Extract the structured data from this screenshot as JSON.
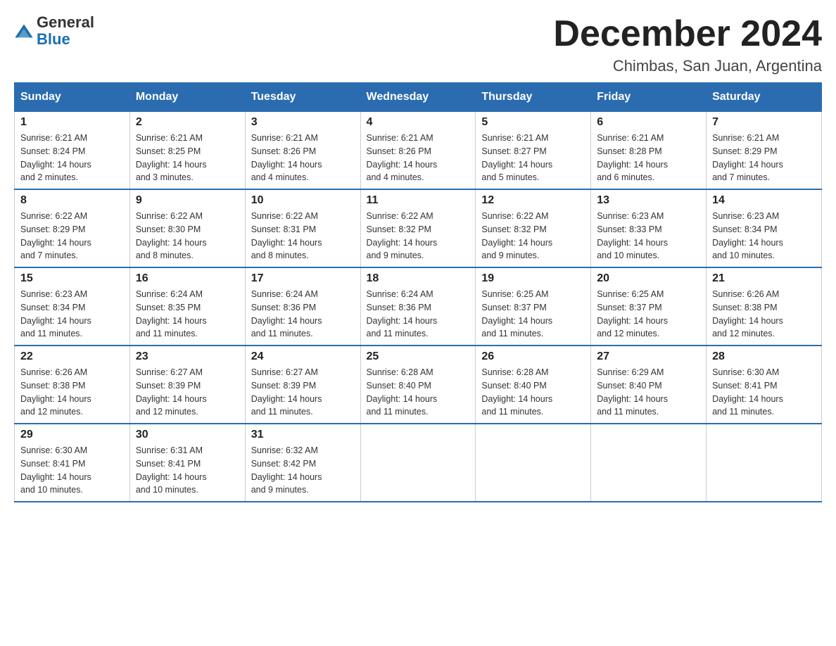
{
  "header": {
    "logo": {
      "general": "General",
      "blue": "Blue"
    },
    "title": "December 2024",
    "subtitle": "Chimbas, San Juan, Argentina"
  },
  "weekdays": [
    "Sunday",
    "Monday",
    "Tuesday",
    "Wednesday",
    "Thursday",
    "Friday",
    "Saturday"
  ],
  "weeks": [
    [
      {
        "day": "1",
        "sunrise": "6:21 AM",
        "sunset": "8:24 PM",
        "daylight": "14 hours and 2 minutes."
      },
      {
        "day": "2",
        "sunrise": "6:21 AM",
        "sunset": "8:25 PM",
        "daylight": "14 hours and 3 minutes."
      },
      {
        "day": "3",
        "sunrise": "6:21 AM",
        "sunset": "8:26 PM",
        "daylight": "14 hours and 4 minutes."
      },
      {
        "day": "4",
        "sunrise": "6:21 AM",
        "sunset": "8:26 PM",
        "daylight": "14 hours and 4 minutes."
      },
      {
        "day": "5",
        "sunrise": "6:21 AM",
        "sunset": "8:27 PM",
        "daylight": "14 hours and 5 minutes."
      },
      {
        "day": "6",
        "sunrise": "6:21 AM",
        "sunset": "8:28 PM",
        "daylight": "14 hours and 6 minutes."
      },
      {
        "day": "7",
        "sunrise": "6:21 AM",
        "sunset": "8:29 PM",
        "daylight": "14 hours and 7 minutes."
      }
    ],
    [
      {
        "day": "8",
        "sunrise": "6:22 AM",
        "sunset": "8:29 PM",
        "daylight": "14 hours and 7 minutes."
      },
      {
        "day": "9",
        "sunrise": "6:22 AM",
        "sunset": "8:30 PM",
        "daylight": "14 hours and 8 minutes."
      },
      {
        "day": "10",
        "sunrise": "6:22 AM",
        "sunset": "8:31 PM",
        "daylight": "14 hours and 8 minutes."
      },
      {
        "day": "11",
        "sunrise": "6:22 AM",
        "sunset": "8:32 PM",
        "daylight": "14 hours and 9 minutes."
      },
      {
        "day": "12",
        "sunrise": "6:22 AM",
        "sunset": "8:32 PM",
        "daylight": "14 hours and 9 minutes."
      },
      {
        "day": "13",
        "sunrise": "6:23 AM",
        "sunset": "8:33 PM",
        "daylight": "14 hours and 10 minutes."
      },
      {
        "day": "14",
        "sunrise": "6:23 AM",
        "sunset": "8:34 PM",
        "daylight": "14 hours and 10 minutes."
      }
    ],
    [
      {
        "day": "15",
        "sunrise": "6:23 AM",
        "sunset": "8:34 PM",
        "daylight": "14 hours and 11 minutes."
      },
      {
        "day": "16",
        "sunrise": "6:24 AM",
        "sunset": "8:35 PM",
        "daylight": "14 hours and 11 minutes."
      },
      {
        "day": "17",
        "sunrise": "6:24 AM",
        "sunset": "8:36 PM",
        "daylight": "14 hours and 11 minutes."
      },
      {
        "day": "18",
        "sunrise": "6:24 AM",
        "sunset": "8:36 PM",
        "daylight": "14 hours and 11 minutes."
      },
      {
        "day": "19",
        "sunrise": "6:25 AM",
        "sunset": "8:37 PM",
        "daylight": "14 hours and 11 minutes."
      },
      {
        "day": "20",
        "sunrise": "6:25 AM",
        "sunset": "8:37 PM",
        "daylight": "14 hours and 12 minutes."
      },
      {
        "day": "21",
        "sunrise": "6:26 AM",
        "sunset": "8:38 PM",
        "daylight": "14 hours and 12 minutes."
      }
    ],
    [
      {
        "day": "22",
        "sunrise": "6:26 AM",
        "sunset": "8:38 PM",
        "daylight": "14 hours and 12 minutes."
      },
      {
        "day": "23",
        "sunrise": "6:27 AM",
        "sunset": "8:39 PM",
        "daylight": "14 hours and 12 minutes."
      },
      {
        "day": "24",
        "sunrise": "6:27 AM",
        "sunset": "8:39 PM",
        "daylight": "14 hours and 11 minutes."
      },
      {
        "day": "25",
        "sunrise": "6:28 AM",
        "sunset": "8:40 PM",
        "daylight": "14 hours and 11 minutes."
      },
      {
        "day": "26",
        "sunrise": "6:28 AM",
        "sunset": "8:40 PM",
        "daylight": "14 hours and 11 minutes."
      },
      {
        "day": "27",
        "sunrise": "6:29 AM",
        "sunset": "8:40 PM",
        "daylight": "14 hours and 11 minutes."
      },
      {
        "day": "28",
        "sunrise": "6:30 AM",
        "sunset": "8:41 PM",
        "daylight": "14 hours and 11 minutes."
      }
    ],
    [
      {
        "day": "29",
        "sunrise": "6:30 AM",
        "sunset": "8:41 PM",
        "daylight": "14 hours and 10 minutes."
      },
      {
        "day": "30",
        "sunrise": "6:31 AM",
        "sunset": "8:41 PM",
        "daylight": "14 hours and 10 minutes."
      },
      {
        "day": "31",
        "sunrise": "6:32 AM",
        "sunset": "8:42 PM",
        "daylight": "14 hours and 9 minutes."
      },
      null,
      null,
      null,
      null
    ]
  ],
  "labels": {
    "sunrise": "Sunrise:",
    "sunset": "Sunset:",
    "daylight": "Daylight:"
  }
}
